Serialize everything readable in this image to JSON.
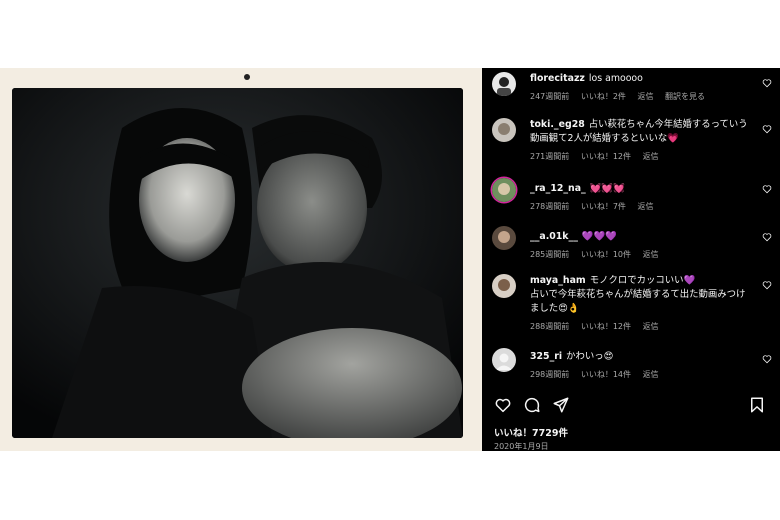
{
  "comments": [
    {
      "username": "florecitazz",
      "text": "los amoooo",
      "time": "247週間前",
      "likes": "いいね！2件",
      "reply": "返信",
      "translate": "翻訳を見る"
    },
    {
      "username": "toki._eg28",
      "text": "占い萩花ちゃん今年結婚するっていう動画観て2人が結婚するといいな",
      "emoji": "💗",
      "time": "271週間前",
      "likes": "いいね！12件",
      "reply": "返信"
    },
    {
      "username": "_ra_12_na_",
      "text": "",
      "emoji": "💓💓💓",
      "time": "278週間前",
      "likes": "いいね！7件",
      "reply": "返信"
    },
    {
      "username": "__a.01k__",
      "text": "",
      "emoji": "💜💜💜",
      "time": "285週間前",
      "likes": "いいね！10件",
      "reply": "返信"
    },
    {
      "username": "maya_ham",
      "text": "モノクロでカッコいい",
      "emoji": "💜",
      "text2": "占いで今年萩花ちゃんが結婚するて出た動画みつけました",
      "emoji2": "😍👌",
      "time": "288週間前",
      "likes": "いいね！12件",
      "reply": "返信"
    },
    {
      "username": "325_ri",
      "text": "かわいっ",
      "emoji": "😍",
      "time": "298週間前",
      "likes": "いいね！14件",
      "reply": "返信"
    }
  ],
  "post": {
    "like_count": "いいね！7729件",
    "date": "2020年1月9日"
  },
  "icons": {
    "like": "heart-icon",
    "comment": "comment-icon",
    "share": "share-icon",
    "save": "bookmark-icon"
  },
  "colors": {
    "panel_bg": "#000000",
    "meta_text": "#a8a8a8",
    "frame": "#f3ede2"
  }
}
